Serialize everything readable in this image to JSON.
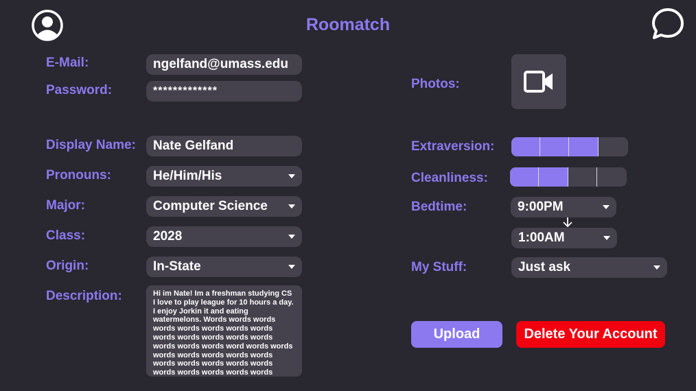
{
  "app": {
    "title": "Roomatch"
  },
  "header": {
    "profile_icon": "user-circle-icon",
    "chat_icon": "chat-bubble-icon"
  },
  "account": {
    "email_label": "E-Mail:",
    "email_value": "ngelfand@umass.edu",
    "password_label": "Password:",
    "password_value": "*************"
  },
  "profile": {
    "display_name_label": "Display Name:",
    "display_name_value": "Nate Gelfand",
    "pronouns_label": "Pronouns:",
    "pronouns_value": "He/Him/His",
    "major_label": "Major:",
    "major_value": "Computer Science",
    "class_label": "Class:",
    "class_value": "2028",
    "origin_label": "Origin:",
    "origin_value": "In-State",
    "description_label": "Description:",
    "description_value": "Hi im Nate! Im a freshman studying CS I love to play league for 10 hours a day. I enjoy Jorkin  it and eating watermelons. Words words words words words words words words words words words words words words words words word words words words words words words words words words words words words words words words words words words words words words words word Words words words words words words words wor..."
  },
  "preferences": {
    "photos_label": "Photos:",
    "photos_icon": "video-camera-icon",
    "extraversion_label": "Extraversion:",
    "extraversion_level": 3,
    "extraversion_max": 4,
    "cleanliness_label": "Cleanliness:",
    "cleanliness_level": 2,
    "cleanliness_max": 4,
    "bedtime_label": "Bedtime:",
    "bedtime_start": "9:00PM",
    "bedtime_end": "1:00AM",
    "mystuff_label": "My Stuff:",
    "mystuff_value": "Just ask"
  },
  "actions": {
    "upload_label": "Upload",
    "delete_label": "Delete Your Account"
  },
  "colors": {
    "background": "#29272f",
    "accent": "#8c79f0",
    "field": "#45424d",
    "danger": "#f1000f"
  }
}
